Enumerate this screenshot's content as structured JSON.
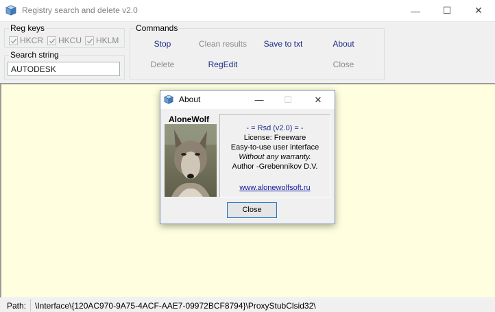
{
  "window": {
    "title": "Registry search and delete v2.0",
    "controls": {
      "minimize": "—",
      "maximize": "☐",
      "close": "✕"
    }
  },
  "reg_keys": {
    "label": "Reg keys",
    "items": [
      {
        "label": "HKCR",
        "checked": true
      },
      {
        "label": "HKCU",
        "checked": true
      },
      {
        "label": "HKLM",
        "checked": true
      }
    ]
  },
  "search": {
    "label": "Search string",
    "value": "AUTODESK"
  },
  "commands": {
    "label": "Commands",
    "stop": "Stop",
    "clean_results": "Clean results",
    "save_to_txt": "Save to txt",
    "about": "About",
    "delete": "Delete",
    "regedit": "RegEdit",
    "close": "Close"
  },
  "status": {
    "label": "Path:",
    "path": "\\Interface\\{120AC970-9A75-4ACF-AAE7-09972BCF8794}\\ProxyStubClsid32\\"
  },
  "about_dialog": {
    "title": "About",
    "author_heading": "AloneWolf",
    "version": "- = Rsd (v2.0) = -",
    "license": "License: Freeware",
    "ui_note": "Easy-to-use user interface",
    "warranty": "Without any warranty.",
    "author": "Author -Grebennikov D.V.",
    "website": "www.alonewolfsoft.ru",
    "close_button": "Close"
  },
  "colors": {
    "results_background": "#ffffe0",
    "active_command": "#1e2a8a",
    "disabled_text": "#8a8a8a",
    "link": "#1a1aa0"
  },
  "icons": {
    "app": "registry-cube-icon",
    "dialog": "registry-cube-icon"
  }
}
